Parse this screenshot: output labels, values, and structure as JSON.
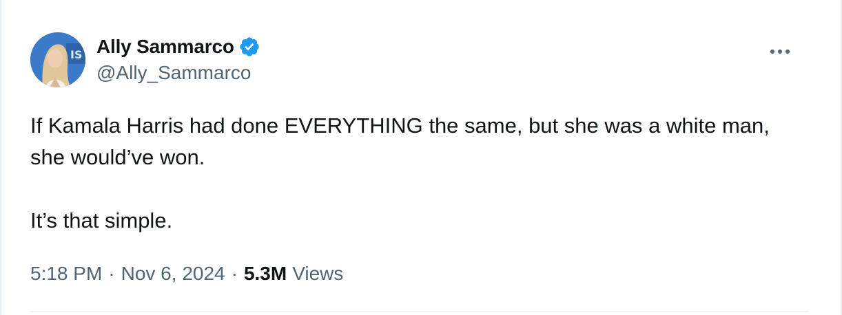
{
  "author": {
    "display_name": "Ally Sammarco",
    "handle": "@Ally_Sammarco",
    "avatar_icon": "profile-photo",
    "verified_icon": "verified-badge-icon",
    "verified_color": "#1d9bf0"
  },
  "tweet": {
    "line1": "If Kamala Harris had done EVERYTHING the same, but she was a white man, she would’ve won.",
    "line2": "It’s that simple."
  },
  "meta": {
    "time": "5:18 PM",
    "separator": "·",
    "date": "Nov 6, 2024",
    "views_count": "5.3M",
    "views_label": "Views"
  },
  "more_icon": "more-horizontal-icon"
}
